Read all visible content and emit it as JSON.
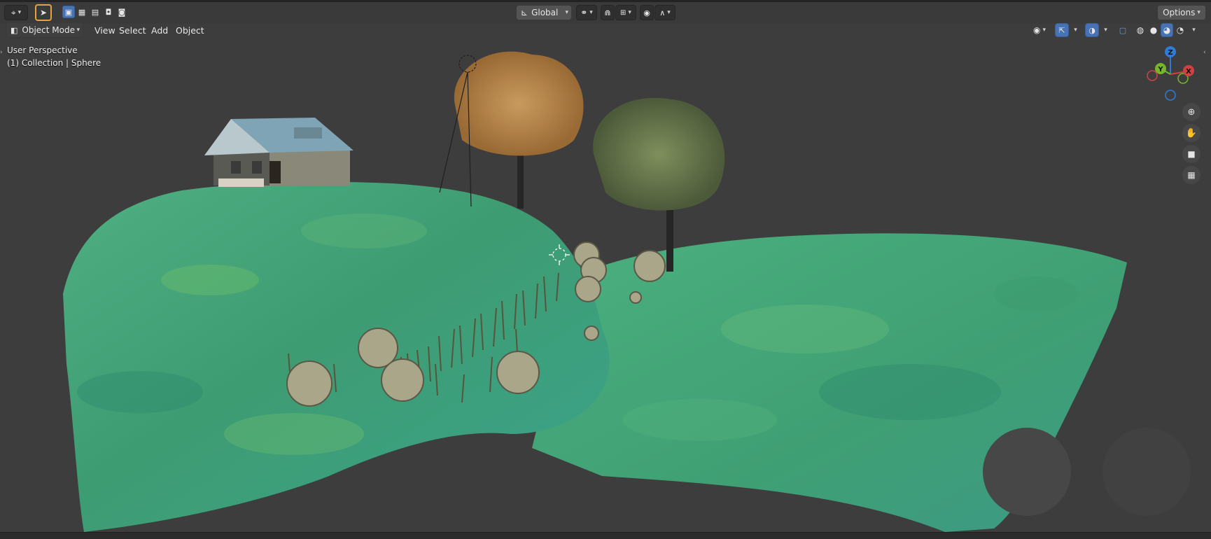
{
  "header": {
    "transform_orientation": "Global",
    "options_label": "Options",
    "mode_label": "Object Mode",
    "menus": [
      {
        "label": "View"
      },
      {
        "label": "Select"
      },
      {
        "label": "Add"
      },
      {
        "label": "Object"
      }
    ],
    "accent_color": "#4772b3"
  },
  "viewport": {
    "perspective_label": "User Perspective",
    "collection_label": "(1) Collection | Sphere"
  },
  "gizmo": {
    "z_label": "Z",
    "y_label": "Y",
    "x_label": "X",
    "x_color": "#d14141",
    "y_color": "#76b72a",
    "z_color": "#2f7cd6"
  }
}
